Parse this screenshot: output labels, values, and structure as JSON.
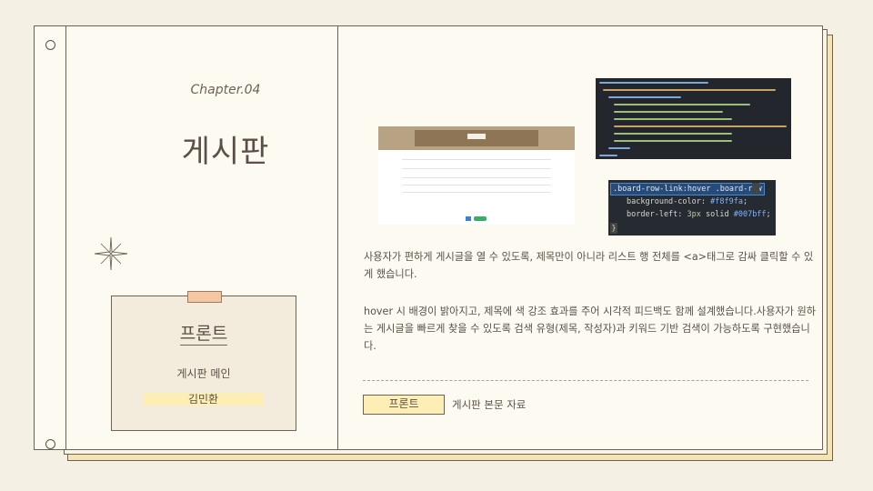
{
  "left_page": {
    "chapter": "Chapter.04",
    "title": "게시판",
    "card": {
      "title": "프론트",
      "subtitle": "게시판 메인",
      "author": "김민환"
    }
  },
  "right_page": {
    "screenshots": {
      "board_preview": "board-page-screenshot",
      "template_code": "thymeleaf-template-code",
      "css_code": {
        "line1": ".board-row-link:hover .board-row",
        "line2_prop": "background-color: ",
        "line2_val": "#f8f9fa",
        "line2_end": ";",
        "line3_prop": "border-left: ",
        "line3_num": "3px",
        "line3_mid": " solid ",
        "line3_val": "#007bff",
        "line3_end": ";",
        "line4": "}"
      }
    },
    "paragraph1": "사용자가 편하게 게시글을 열 수 있도록, 제목만이 아니라 리스트 행 전체를 <a>태그로 감싸 클릭할 수 있게 했습니다.",
    "paragraph2": "hover 시 배경이 밝아지고, 제목에 색 강조 효과를 주어 시각적 피드백도 함께 설계했습니다.사용자가 원하는 게시글을 빠르게 찾을 수 있도록 검색 유형(제목, 작성자)과 키워드 기반 검색이 가능하도록 구현했습니다.",
    "footer": {
      "badge": "프론트",
      "caption": "게시판 본문 자료"
    }
  },
  "colors": {
    "page_bg": "#f5f0e4",
    "paper": "#fcfaf1",
    "highlight": "#fdeeb5",
    "tape": "#f5c6a2",
    "border": "#6d6256"
  }
}
